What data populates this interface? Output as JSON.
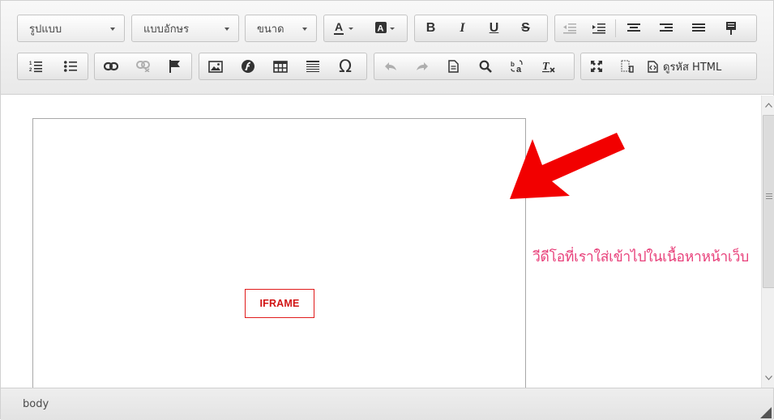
{
  "toolbar": {
    "format_label": "รูปแบบ",
    "font_label": "แบบอักษร",
    "size_label": "ขนาด",
    "bold": "B",
    "italic": "I",
    "underline": "U",
    "strike": "S",
    "omega": "Ω",
    "source_label": "ดูรหัส HTML"
  },
  "content": {
    "iframe_label": "IFRAME",
    "annotation": "วีดีโอที่เราใส่เข้าไปในเนื้อหาหน้าเว็บ"
  },
  "statusbar": {
    "path": "body"
  },
  "colors": {
    "annotation": "#e8407a",
    "iframe_label": "#d11414",
    "arrow": "#f20000"
  }
}
